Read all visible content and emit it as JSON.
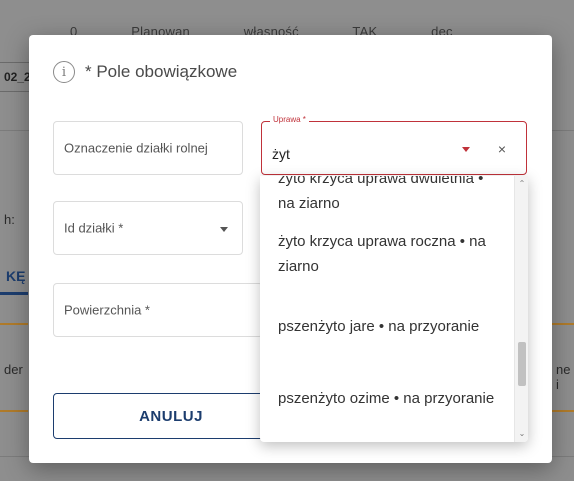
{
  "background": {
    "row_values": [
      "0",
      "Planowan",
      "własność",
      "TAK",
      "",
      "dec"
    ],
    "field_fragment": "02_2",
    "label_fragment": "h:",
    "tab_fragment": "KĘ",
    "left_fragment": "der",
    "right_fragment": "ne i"
  },
  "modal": {
    "required_hint": "* Pole obowiązkowe",
    "info_icon_glyph": "i",
    "fields": {
      "oznaczenie_label": "Oznaczenie działki rolnej",
      "id_label": "Id działki *",
      "powierzchnia_label": "Powierzchnia *",
      "uprawa_label": "Uprawa *",
      "uprawa_value": "żyt",
      "clear_glyph": "×"
    },
    "cancel_label": "ANULUJ",
    "accent_color": "#c0323a",
    "primary_color": "#1c3d6e"
  },
  "dropdown": {
    "options": [
      "żyto krzyca uprawa dwuletnia • na ziarno",
      "żyto krzyca uprawa roczna • na ziarno",
      "pszenżyto jare • na przyoranie",
      "pszenżyto ozime • na przyoranie"
    ],
    "scroll_up_glyph": "⌃",
    "scroll_down_glyph": "⌄"
  }
}
